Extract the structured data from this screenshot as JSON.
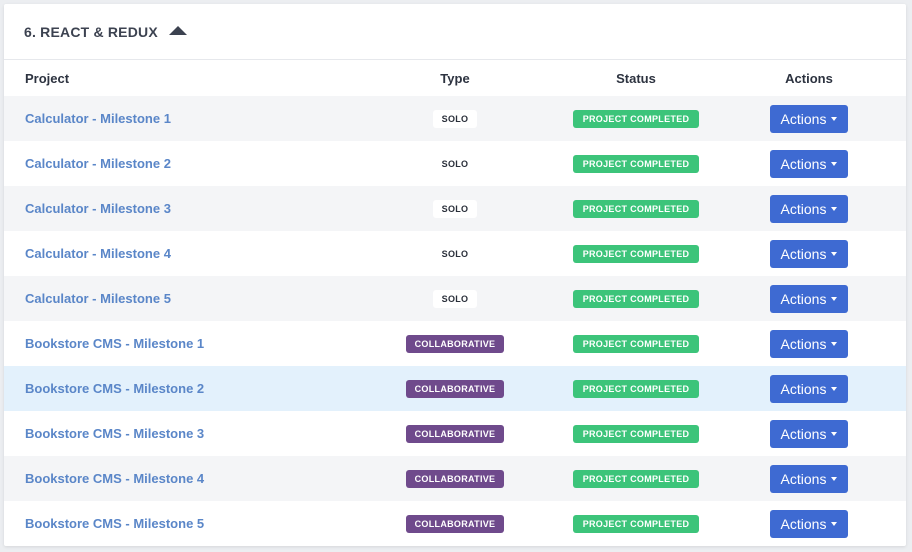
{
  "section": {
    "title": "6. REACT & REDUX",
    "toggle_icon": "caret-up-icon"
  },
  "columns": {
    "project": "Project",
    "type": "Type",
    "status": "Status",
    "actions": "Actions"
  },
  "colors": {
    "link": "#5a86c8",
    "status_green": "#3cc47a",
    "collab_purple": "#6f4a8c",
    "action_blue": "#3e6ad2",
    "highlight_row": "#e3f1fc"
  },
  "rows": [
    {
      "project": "Calculator - Milestone 1",
      "type": "SOLO",
      "status": "PROJECT COMPLETED",
      "action": "Actions"
    },
    {
      "project": "Calculator - Milestone 2",
      "type": "SOLO",
      "status": "PROJECT COMPLETED",
      "action": "Actions"
    },
    {
      "project": "Calculator - Milestone 3",
      "type": "SOLO",
      "status": "PROJECT COMPLETED",
      "action": "Actions"
    },
    {
      "project": "Calculator - Milestone 4",
      "type": "SOLO",
      "status": "PROJECT COMPLETED",
      "action": "Actions"
    },
    {
      "project": "Calculator - Milestone 5",
      "type": "SOLO",
      "status": "PROJECT COMPLETED",
      "action": "Actions"
    },
    {
      "project": "Bookstore CMS - Milestone 1",
      "type": "COLLABORATIVE",
      "status": "PROJECT COMPLETED",
      "action": "Actions"
    },
    {
      "project": "Bookstore CMS - Milestone 2",
      "type": "COLLABORATIVE",
      "status": "PROJECT COMPLETED",
      "action": "Actions"
    },
    {
      "project": "Bookstore CMS - Milestone 3",
      "type": "COLLABORATIVE",
      "status": "PROJECT COMPLETED",
      "action": "Actions"
    },
    {
      "project": "Bookstore CMS - Milestone 4",
      "type": "COLLABORATIVE",
      "status": "PROJECT COMPLETED",
      "action": "Actions"
    },
    {
      "project": "Bookstore CMS - Milestone 5",
      "type": "COLLABORATIVE",
      "status": "PROJECT COMPLETED",
      "action": "Actions"
    }
  ]
}
